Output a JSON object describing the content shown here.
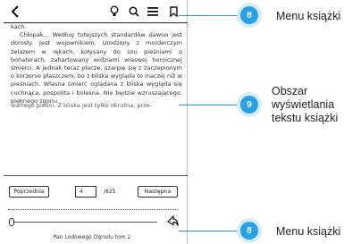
{
  "topbar": {
    "back_icon": "chevron-left-icon",
    "icons": [
      "lightbulb-icon",
      "search-icon",
      "menu-icon",
      "bookmark-icon"
    ]
  },
  "reader": {
    "text_fragment": "kach.",
    "paragraph": "Chłopak... Według tutejszych standardów dawno jest dorosły. Jest wojownikiem. Urodzony z morderczym żelazem w rękach, kołysany do snu pieśniami o bohaterach, zahartowany widziami wiaswej heroicznej śmierci. A jednak teraz płacze, szarpie się z zaczepionym o korzenie płaszczem, bo z bliska wygląda to inaczej niż w pieśniach. Własna śmierć oglądana z bliska wygląda się cuchnąca, pospolita i bolesna. Nie będzie wzruszającego, pięknego zgonu",
    "cut_line": "wartego pieśni. Z bliska jest tylko okrutna, prze-"
  },
  "pager": {
    "prev_label": "Poprzednia",
    "next_label": "Następna",
    "page_value": "4",
    "page_total": "/825"
  },
  "progress": {
    "fraction": 0.005
  },
  "chapter_title": "Pan Lodowego Ogrodu tom 2",
  "annotations": {
    "top": {
      "number": "8",
      "label": "Menu książki"
    },
    "middle": {
      "number": "9",
      "label_lines": [
        "Obszar",
        "wyświetlania",
        "tekstu książki"
      ]
    },
    "bottom": {
      "number": "8",
      "label": "Menu książki"
    }
  },
  "colors": {
    "accent": "#29a0e6"
  }
}
